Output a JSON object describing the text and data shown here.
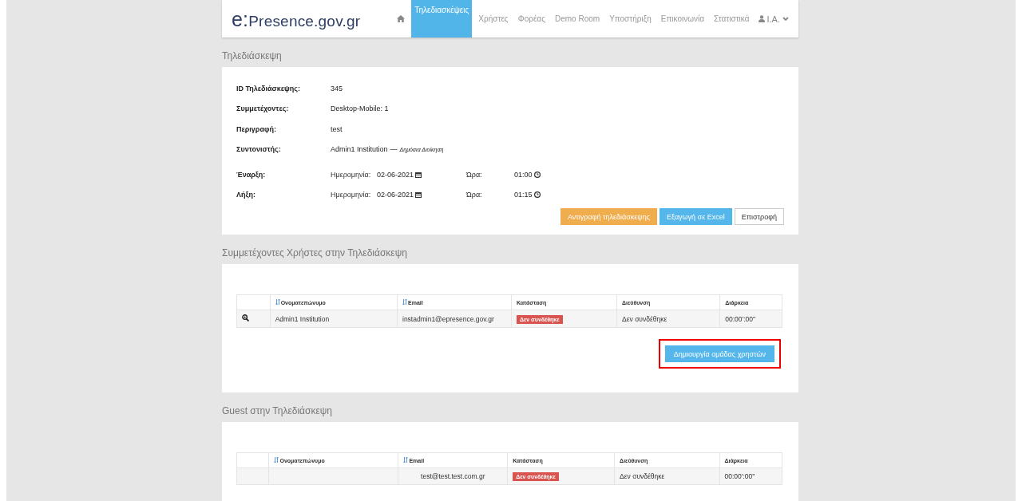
{
  "header": {
    "logo_prefix": "e:",
    "logo_rest": "Presence.gov.gr",
    "nav": [
      {
        "label": "Τηλεδιασκέψεις",
        "selected": true
      },
      {
        "label": "Χρήστες",
        "selected": false
      },
      {
        "label": "Φορέας",
        "selected": false
      },
      {
        "label": "Demo Room",
        "selected": false
      },
      {
        "label": "Υποστήριξη",
        "selected": false
      },
      {
        "label": "Επικοινωνία",
        "selected": false
      },
      {
        "label": "Στατιστικά",
        "selected": false
      }
    ],
    "user": "I.A."
  },
  "conference": {
    "title": "Τηλεδιάσκεψη",
    "fields": [
      {
        "label": "ID Τηλεδιάσκεψης:",
        "value": "345"
      },
      {
        "label": "Συμμετέχοντες:",
        "value": "Desktop-Mobile: 1"
      },
      {
        "label": "Περιγραφή:",
        "value": "test"
      },
      {
        "label": "Συντονιστής:",
        "value": "Admin1 Institution",
        "separator": "—",
        "note": "Δημόσια Διοίκηση"
      }
    ],
    "times": [
      {
        "label": "Έναρξη:",
        "date_label": "Ημερομηνία:",
        "date": "02-06-2021",
        "time_label": "Ώρα:",
        "time": "01:00"
      },
      {
        "label": "Λήξη:",
        "date_label": "Ημερομηνία:",
        "date": "02-06-2021",
        "time_label": "Ώρα:",
        "time": "01:15"
      }
    ],
    "buttons": [
      {
        "label": "Αντιγραφή τηλεδιάσκεψης",
        "kind": "warning"
      },
      {
        "label": "Εξαγωγή σε Excel",
        "kind": "info"
      },
      {
        "label": "Επιστροφή",
        "kind": "default"
      }
    ]
  },
  "participants": {
    "title": "Συμμετέχοντες Χρήστες στην Τηλεδιάσκεψη",
    "columns": [
      {
        "label": "Ονοματεπώνυμο",
        "sortable": true
      },
      {
        "label": "Email",
        "sortable": true
      },
      {
        "label": "Κατάσταση",
        "sortable": false
      },
      {
        "label": "Διεύθυνση",
        "sortable": false
      },
      {
        "label": "Διάρκεια",
        "sortable": false
      }
    ],
    "rows": [
      {
        "has_zoom": true,
        "name": "Admin1 Institution",
        "email": "instadmin1@epresence.gov.gr",
        "status": "Δεν συνδέθηκε",
        "address": "Δεν συνδέθηκε",
        "duration": "00:00':00''"
      }
    ],
    "action": "Δημιουργία ομάδας χρηστών"
  },
  "guests": {
    "title": "Guest στην Τηλεδιάσκεψη",
    "columns": [
      {
        "label": "Ονοματεπώνυμο",
        "sortable": true
      },
      {
        "label": "Email",
        "sortable": true
      },
      {
        "label": "Κατάσταση",
        "sortable": false
      },
      {
        "label": "Διεύθυνση",
        "sortable": false
      },
      {
        "label": "Διάρκεια",
        "sortable": false
      }
    ],
    "rows": [
      {
        "has_zoom": false,
        "name": "",
        "email": "test@test.test.com.gr",
        "status": "Δεν συνδέθηκε",
        "address": "Δεν συνδέθηκε",
        "duration": "00:00':00''"
      }
    ]
  }
}
